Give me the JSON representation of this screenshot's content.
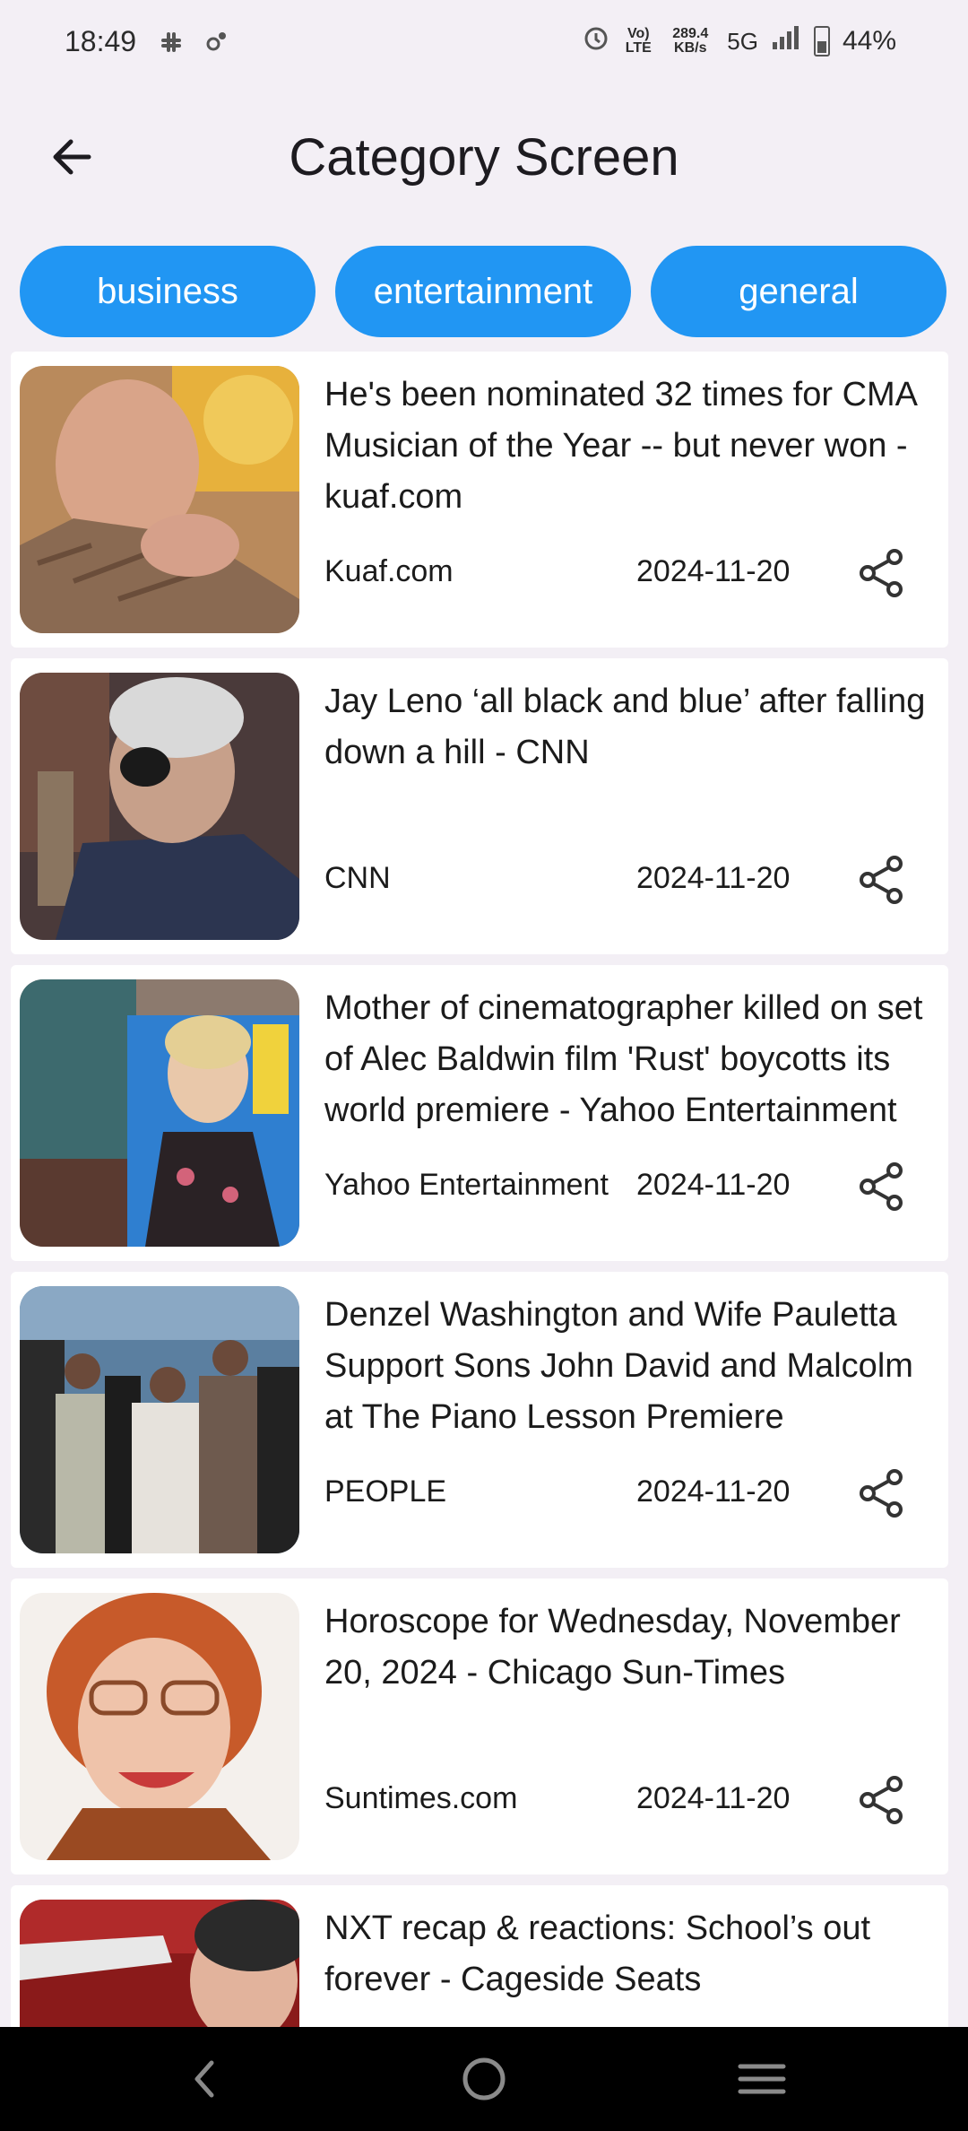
{
  "status_bar": {
    "time": "18:49",
    "net_volte": "Vo) LTE",
    "net_speed": "289.4 KB/s",
    "net_type": "5G",
    "battery": "44%"
  },
  "app_bar": {
    "title": "Category Screen"
  },
  "categories": [
    "business",
    "entertainment",
    "general"
  ],
  "articles": [
    {
      "headline": "He's been nominated 32 times for CMA Musician of the Year -- but never won - kuaf.com",
      "source": "Kuaf.com",
      "date": "2024-11-20"
    },
    {
      "headline": "Jay Leno ‘all black and blue’ after falling down a hill - CNN",
      "source": "CNN",
      "date": "2024-11-20"
    },
    {
      "headline": "Mother of cinematographer killed on set of Alec Baldwin film 'Rust' boycotts its world premiere - Yahoo Entertainment",
      "source": "Yahoo Entertainment",
      "date": "2024-11-20"
    },
    {
      "headline": "Denzel Washington and Wife Pauletta Support Sons John David and Malcolm at The Piano Lesson Premiere",
      "source": "PEOPLE",
      "date": "2024-11-20"
    },
    {
      "headline": "Horoscope for Wednesday, November 20, 2024 - Chicago Sun-Times",
      "source": "Suntimes.com",
      "date": "2024-11-20"
    },
    {
      "headline": "NXT recap & reactions: School’s out forever - Cageside Seats",
      "source": "",
      "date": ""
    }
  ],
  "colors": {
    "chip": "#2196f3",
    "background": "#f3eff5",
    "card": "#ffffff",
    "nav_bar": "#000000"
  },
  "icons": {
    "back": "arrow-left-icon",
    "share": "share-icon",
    "nav_back": "chevron-left-icon",
    "nav_home": "circle-home-icon",
    "nav_menu": "hamburger-menu-icon"
  }
}
